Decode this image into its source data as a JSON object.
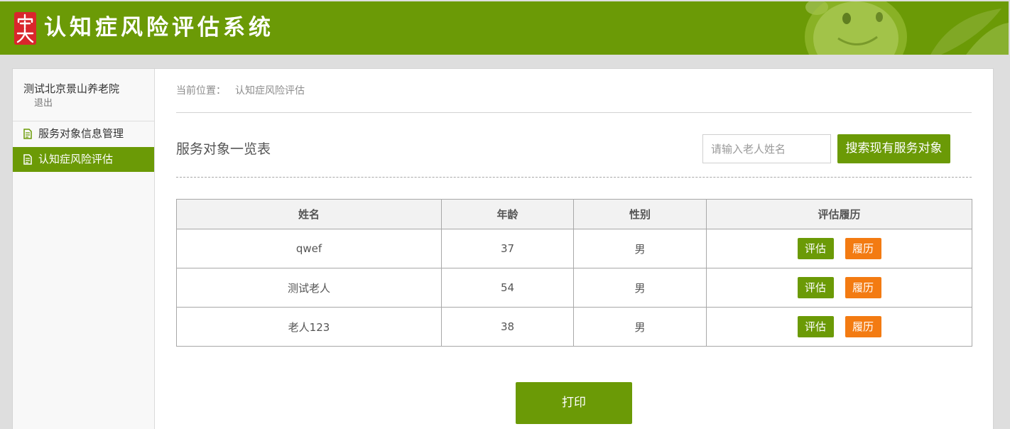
{
  "header": {
    "title": "认知症风险评估系统"
  },
  "sidebar": {
    "org_name": "测试北京景山养老院",
    "logout_label": "退出",
    "items": [
      {
        "label": "服务对象信息管理",
        "icon": "document-icon",
        "active": false
      },
      {
        "label": "认知症风险评估",
        "icon": "document-icon",
        "active": true
      }
    ]
  },
  "main": {
    "breadcrumb": {
      "prefix": "当前位置：",
      "current": "认知症风险评估"
    },
    "section_title": "服务对象一览表",
    "search": {
      "placeholder": "请输入老人姓名",
      "value": "",
      "button_label": "搜索现有服务对象"
    },
    "table": {
      "columns": [
        "姓名",
        "年龄",
        "性别",
        "评估履历"
      ],
      "rows": [
        {
          "name": "qwef",
          "age": 37,
          "gender": "男"
        },
        {
          "name": "测试老人",
          "age": 54,
          "gender": "男"
        },
        {
          "name": "老人123",
          "age": 38,
          "gender": "男"
        }
      ],
      "row_actions": {
        "assess_label": "评估",
        "history_label": "履历"
      }
    },
    "print_label": "打印"
  },
  "theme": {
    "primary_green": "#6b9a06",
    "accent_orange": "#f37b12"
  }
}
